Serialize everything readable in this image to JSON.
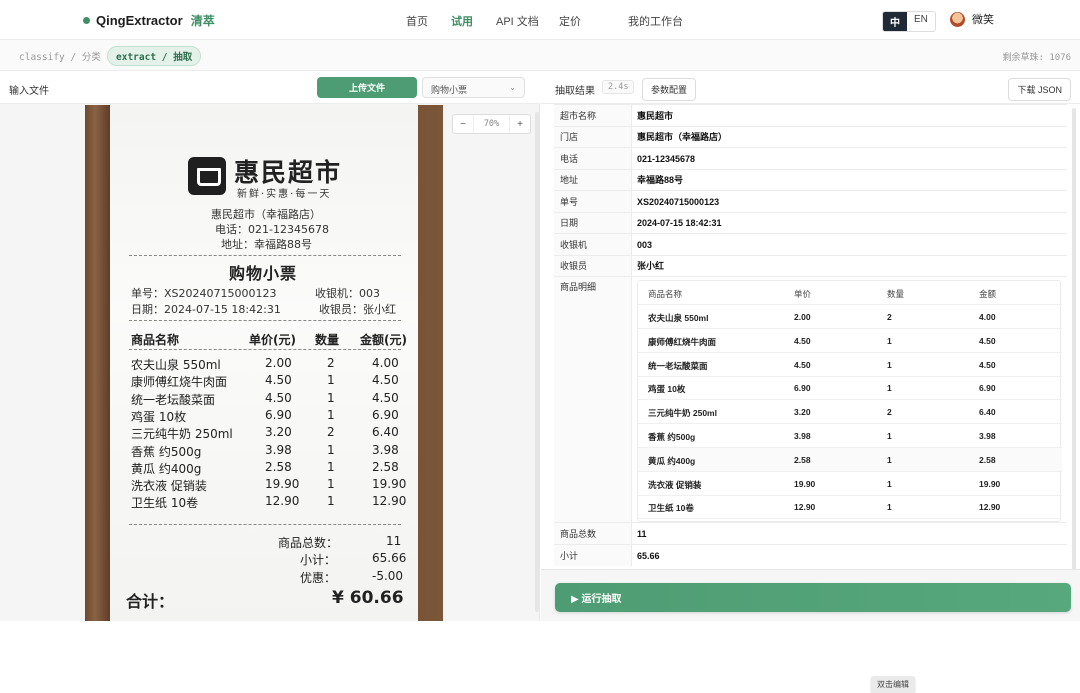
{
  "nav": {
    "brand": "QingExtractor",
    "brand_cn": "清萃",
    "links": [
      "首页",
      "试用",
      "API 文档",
      "定价",
      "我的工作台"
    ],
    "lang_zh": "中",
    "lang_en": "EN",
    "user_name": "微笑"
  },
  "subbar": {
    "crumb_classify": "classify / 分类",
    "crumb_extract": "extract / 抽取",
    "quota": "剩余草珠: 1076"
  },
  "left": {
    "title": "输入文件",
    "upload_label": "上传文件",
    "doc_type": "购物小票",
    "zoom": "70%"
  },
  "receipt": {
    "store": "惠民超市",
    "slogan": "新鲜·实惠·每一天",
    "branch": "惠民超市（幸福路店）",
    "phone": "电话：021-12345678",
    "address": "地址：幸福路88号",
    "title": "购物小票",
    "order_no": "单号：XS20240715000123",
    "register": "收银机：003",
    "date": "日期：2024-07-15 18:42:31",
    "cashier": "收银员：张小红",
    "headers": [
      "商品名称",
      "单价(元)",
      "数量",
      "金额(元)"
    ],
    "rows": [
      [
        "农夫山泉 550ml",
        "2.00",
        "2",
        "4.00"
      ],
      [
        "康师傅红烧牛肉面",
        "4.50",
        "1",
        "4.50"
      ],
      [
        "统一老坛酸菜面",
        "4.50",
        "1",
        "4.50"
      ],
      [
        "鸡蛋 10枚",
        "6.90",
        "1",
        "6.90"
      ],
      [
        "三元纯牛奶 250ml",
        "3.20",
        "2",
        "6.40"
      ],
      [
        "香蕉 约500g",
        "3.98",
        "1",
        "3.98"
      ],
      [
        "黄瓜 约400g",
        "2.58",
        "1",
        "2.58"
      ],
      [
        "洗衣液 促销装",
        "19.90",
        "1",
        "19.90"
      ],
      [
        "卫生纸 10卷",
        "12.90",
        "1",
        "12.90"
      ]
    ],
    "total_count_label": "商品总数：",
    "total_count": "11",
    "subtotal_label": "小计：",
    "subtotal": "65.66",
    "discount_label": "优惠：",
    "discount": "-5.00",
    "total_label": "合计：",
    "total": "¥ 60.66"
  },
  "right": {
    "title": "抽取结果",
    "time": "2.4s",
    "params_label": "参数配置",
    "download_label": "下载 JSON",
    "fields": [
      {
        "k": "超市名称",
        "v": "惠民超市"
      },
      {
        "k": "门店",
        "v": "惠民超市（幸福路店）"
      },
      {
        "k": "电话",
        "v": "021-12345678"
      },
      {
        "k": "地址",
        "v": "幸福路88号"
      },
      {
        "k": "单号",
        "v": "XS20240715000123"
      },
      {
        "k": "日期",
        "v": "2024-07-15 18:42:31"
      },
      {
        "k": "收银机",
        "v": "003"
      },
      {
        "k": "收银员",
        "v": "张小红"
      },
      {
        "k": "商品明细",
        "v": ""
      }
    ],
    "items_headers": [
      "商品名称",
      "单价",
      "数量",
      "金额"
    ],
    "items": [
      [
        "农夫山泉 550ml",
        "2.00",
        "2",
        "4.00"
      ],
      [
        "康师傅红烧牛肉面",
        "4.50",
        "1",
        "4.50"
      ],
      [
        "统一老坛酸菜面",
        "4.50",
        "1",
        "4.50"
      ],
      [
        "鸡蛋 10枚",
        "6.90",
        "1",
        "6.90"
      ],
      [
        "三元纯牛奶 250ml",
        "3.20",
        "2",
        "6.40"
      ],
      [
        "香蕉 约500g",
        "3.98",
        "1",
        "3.98"
      ],
      [
        "黄瓜 约400g",
        "2.58",
        "1",
        "2.58"
      ],
      [
        "洗衣液 促销装",
        "19.90",
        "1",
        "19.90"
      ],
      [
        "卫生纸 10卷",
        "12.90",
        "1",
        "12.90"
      ]
    ],
    "tooltip": "双击编辑",
    "tail_fields": [
      {
        "k": "商品总数",
        "v": "11"
      },
      {
        "k": "小计",
        "v": "65.66"
      }
    ],
    "run_label": "▶ 运行抽取"
  }
}
